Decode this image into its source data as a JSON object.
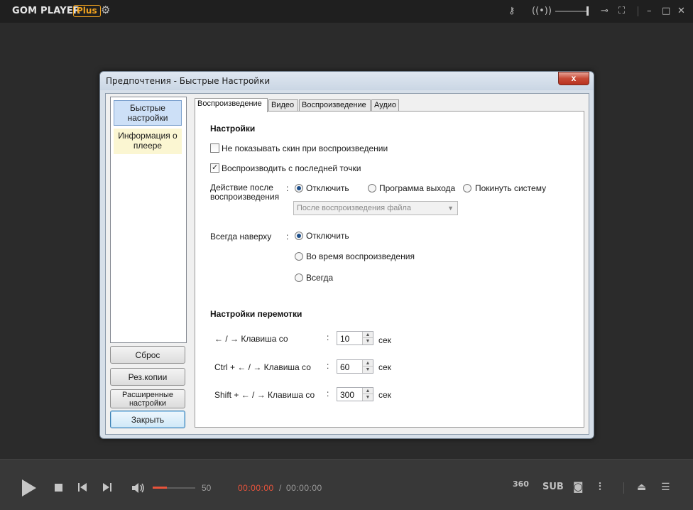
{
  "app": {
    "brand": "GOM PLAYER",
    "badge": "Plus"
  },
  "player": {
    "volume_value": "50",
    "time_current": "00:00:00",
    "time_separator": "/",
    "time_total": "00:00:00",
    "label_360": "360",
    "label_sub": "SUB",
    "accent_color": "#e8533b"
  },
  "dialog": {
    "title": "Предпочтения - Быстрые Настройки",
    "close_label": "x",
    "nav": [
      {
        "label": "Быстрые настройки"
      },
      {
        "label": "Информация о плеере"
      }
    ],
    "buttons": {
      "reset": "Сброс",
      "backup": "Рез.копии",
      "advanced": "Расширенные настройки",
      "close": "Закрыть"
    },
    "tabs": [
      {
        "label": "Воспроизведение"
      },
      {
        "label": "Видео"
      },
      {
        "label": "Воспроизведение"
      },
      {
        "label": "Аудио"
      }
    ],
    "settings": {
      "heading": "Настройки",
      "no_skin_label": "Не показывать скин при воспроизведении",
      "no_skin_checked": false,
      "resume_label": "Воспроизводить с последней точки",
      "resume_checked": true,
      "after_play_label": "Действие после воспроизведения",
      "colon": ":",
      "after_play_options": [
        "Отключить",
        "Программа выхода",
        "Покинуть систему"
      ],
      "after_play_selected": "Отключить",
      "after_play_combo": "После воспроизведения файла",
      "always_on_top_label": "Всегда наверху",
      "always_on_top_options": [
        "Отключить",
        "Во время воспроизведения",
        "Всегда"
      ],
      "always_on_top_selected": "Отключить"
    },
    "seek": {
      "heading": "Настройки перемотки",
      "unit": "сек",
      "rows": [
        {
          "label": "← / → Клавиша со",
          "value": "10"
        },
        {
          "label": "Ctrl + ← / → Клавиша со",
          "value": "60"
        },
        {
          "label": "Shift + ← / → Клавиша со",
          "value": "300"
        }
      ]
    }
  }
}
